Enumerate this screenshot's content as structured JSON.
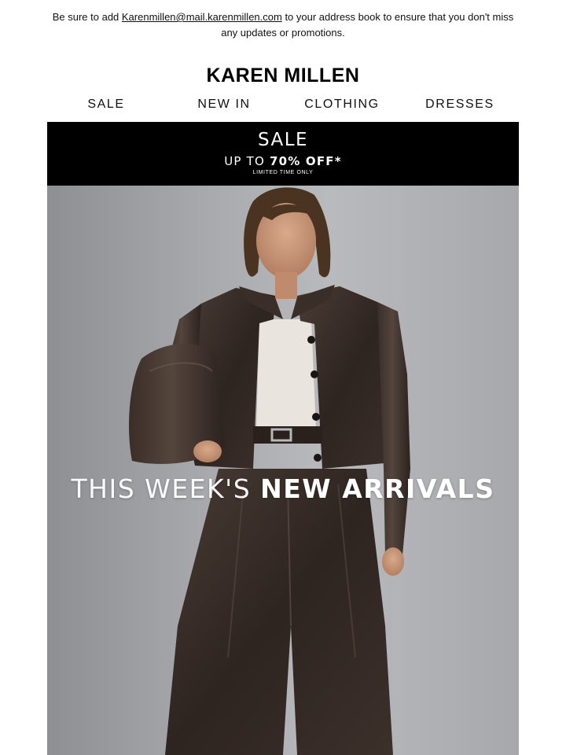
{
  "preheader": {
    "before": "Be sure to add ",
    "email_link": "Karenmillen@mail.karenmillen.com",
    "after": " to your address book to ensure that you don't miss any updates or promotions."
  },
  "logo": {
    "text": "KAREN MILLEN"
  },
  "nav": {
    "items": [
      {
        "label": "SALE"
      },
      {
        "label": "NEW IN"
      },
      {
        "label": "CLOTHING"
      },
      {
        "label": "DRESSES"
      }
    ]
  },
  "sale_banner": {
    "title": "SALE",
    "subtitle_prefix": "UP TO ",
    "subtitle_strong": "70% OFF*",
    "fine_print": "LIMITED TIME ONLY",
    "background": "#000000",
    "text_color": "#ffffff"
  },
  "hero": {
    "headline_light": "THIS WEEK'S ",
    "headline_bold": "NEW ARRIVALS",
    "image_subject": "model-in-brown-leather-jacket-and-culottes-photo"
  }
}
